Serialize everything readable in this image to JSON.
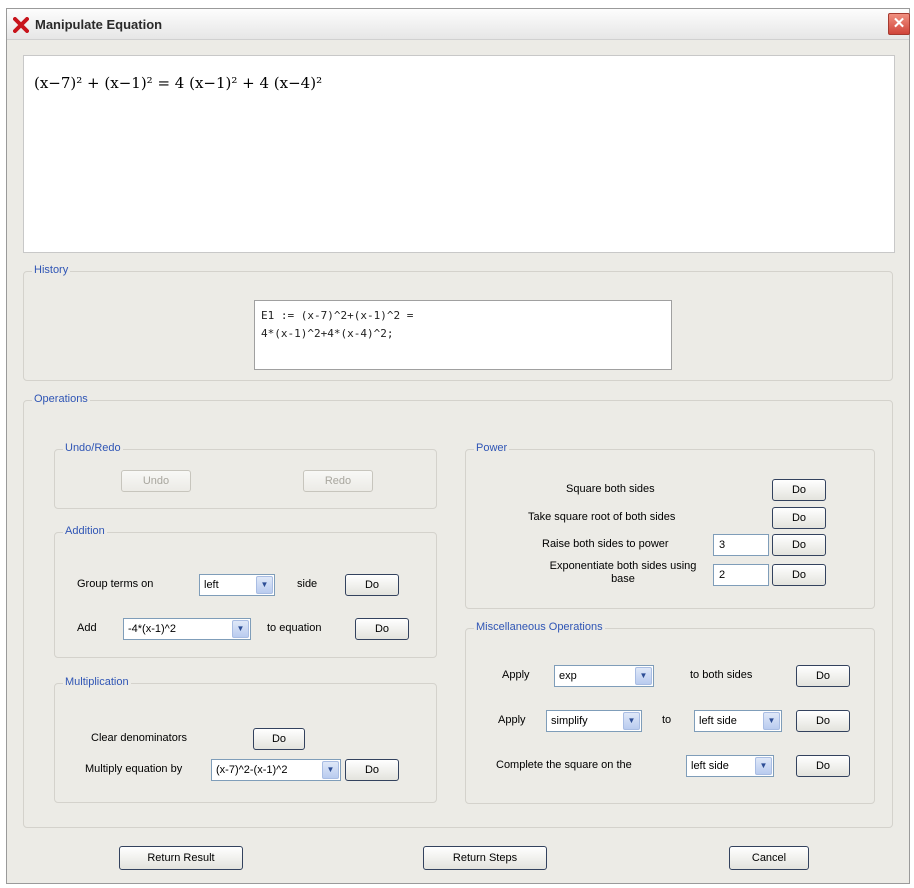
{
  "window": {
    "title": "Manipulate Equation",
    "close_glyph": "✕",
    "icon": "red-x-app-icon"
  },
  "equation": {
    "display": "(x−7)² + (x−1)² = 4 (x−1)² + 4 (x−4)²"
  },
  "history": {
    "label": "History",
    "line1": "E1 := (x-7)^2+(x-1)^2 =",
    "line2": "4*(x-1)^2+4*(x-4)^2;"
  },
  "operations": {
    "label": "Operations",
    "undo_redo": {
      "label": "Undo/Redo",
      "undo": "Undo",
      "redo": "Redo"
    },
    "addition": {
      "label": "Addition",
      "group_label": "Group terms on",
      "group_value": "left",
      "side_label": "side",
      "do": "Do",
      "add_label": "Add",
      "add_value": "-4*(x-1)^2",
      "to_equation_label": "to equation"
    },
    "multiplication": {
      "label": "Multiplication",
      "clear_label": "Clear denominators",
      "do": "Do",
      "multiply_label": "Multiply equation by",
      "multiply_value": "(x-7)^2-(x-1)^2"
    },
    "power": {
      "label": "Power",
      "square_label": "Square both sides",
      "sqrt_label": "Take square root of both sides",
      "raise_label": "Raise both sides to power",
      "raise_value": "3",
      "exp_label": "Exponentiate both sides using base",
      "exp_value": "2",
      "do": "Do"
    },
    "misc": {
      "label": "Miscellaneous Operations",
      "apply_label": "Apply",
      "apply_func": "exp",
      "both_sides_label": "to both sides",
      "apply2_func": "simplify",
      "to_label": "to",
      "apply2_side": "left side",
      "complete_label": "Complete the square on the",
      "complete_side": "left side",
      "do": "Do"
    }
  },
  "footer": {
    "return_result": "Return Result",
    "return_steps": "Return Steps",
    "cancel": "Cancel"
  }
}
